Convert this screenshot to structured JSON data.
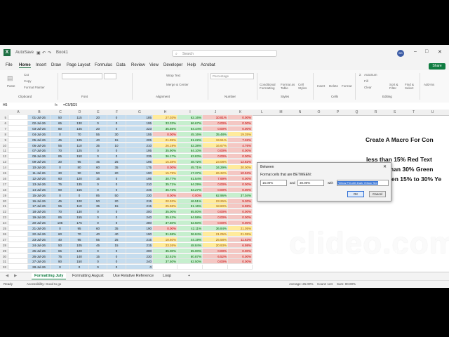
{
  "titlebar": {
    "autosave_label": "AutoSave",
    "workbook": "Book1",
    "search_placeholder": "Search",
    "user_initials": "BS"
  },
  "menu": [
    "File",
    "Home",
    "Insert",
    "Draw",
    "Page Layout",
    "Formulas",
    "Data",
    "Review",
    "View",
    "Developer",
    "Help",
    "Acrobat"
  ],
  "share_label": "Share",
  "ribbon": {
    "paste": "Paste",
    "cut": "Cut",
    "copy": "Copy",
    "format_painter": "Format Painter",
    "clipboard": "Clipboard",
    "font": "Font",
    "wrap_text": "Wrap Text",
    "merge_center": "Merge & Center",
    "alignment": "Alignment",
    "number_format": "Percentage",
    "number": "Number",
    "conditional": "Conditional Formatting",
    "format_table": "Format as Table",
    "cell_styles": "Cell Styles",
    "styles": "Styles",
    "insert": "Insert",
    "delete": "Delete",
    "format": "Format",
    "cells": "Cells",
    "autosum": "AutoSum",
    "fill": "Fill",
    "clear": "Clear",
    "sort_filter": "Sort & Filter",
    "find_select": "Find & Select",
    "editing": "Editing",
    "addins": "Add-ins"
  },
  "formula_bar": {
    "name_box": "H5",
    "fx": "fx",
    "formula": "=C5/$G5"
  },
  "columns": [
    "A",
    "B",
    "C",
    "D",
    "E",
    "F",
    "G",
    "H",
    "I",
    "J",
    "K",
    "L",
    "M",
    "N",
    "O",
    "P",
    "Q",
    "R",
    "S",
    "T",
    "U"
  ],
  "sheet_rows": [
    {
      "n": "5",
      "date": "01-Jul-26",
      "c": "50",
      "d": "115",
      "e": "20",
      "f": "0",
      "g": "185",
      "h": "27.03%",
      "i": "62.16%",
      "j": "10.81%",
      "k": "0.00%",
      "hs": "yellow",
      "is": "green",
      "js": "red",
      "ks": "red"
    },
    {
      "n": "6",
      "date": "02-Jul-26",
      "c": "65",
      "d": "130",
      "e": "0",
      "f": "0",
      "g": "195",
      "h": "33.33%",
      "i": "66.67%",
      "j": "0.00%",
      "k": "0.00%",
      "hs": "green",
      "is": "green",
      "js": "red",
      "ks": "red"
    },
    {
      "n": "7",
      "date": "03-Jul-26",
      "c": "80",
      "d": "145",
      "e": "20",
      "f": "0",
      "g": "223",
      "h": "35.56%",
      "i": "64.44%",
      "j": "0.00%",
      "k": "0.00%",
      "hs": "green",
      "is": "green",
      "js": "red",
      "ks": "red"
    },
    {
      "n": "8",
      "date": "04-Jul-26",
      "c": "0",
      "d": "70",
      "e": "55",
      "f": "30",
      "g": "155",
      "h": "0.00%",
      "i": "45.16%",
      "j": "35.48%",
      "k": "19.35%",
      "hs": "red",
      "is": "green",
      "js": "green",
      "ks": "yellow"
    },
    {
      "n": "9",
      "date": "05-Jul-26",
      "c": "45",
      "d": "105",
      "e": "40",
      "f": "15",
      "g": "205",
      "h": "21.95%",
      "i": "51.22%",
      "j": "19.51%",
      "k": "7.32%",
      "hs": "yellow",
      "is": "green",
      "js": "yellow",
      "ks": "red"
    },
    {
      "n": "10",
      "date": "06-Jul-26",
      "c": "55",
      "d": "110",
      "e": "35",
      "f": "10",
      "g": "210",
      "h": "26.19%",
      "i": "52.38%",
      "j": "16.67%",
      "k": "4.76%",
      "hs": "yellow",
      "is": "green",
      "js": "yellow",
      "ks": "red"
    },
    {
      "n": "11",
      "date": "07-Jul-26",
      "c": "70",
      "d": "125",
      "e": "0",
      "f": "0",
      "g": "195",
      "h": "35.90%",
      "i": "64.10%",
      "j": "0.00%",
      "k": "0.00%",
      "hs": "green",
      "is": "green",
      "js": "red",
      "ks": "red"
    },
    {
      "n": "12",
      "date": "08-Jul-26",
      "c": "85",
      "d": "150",
      "e": "0",
      "f": "0",
      "g": "235",
      "h": "36.17%",
      "i": "63.83%",
      "j": "0.00%",
      "k": "0.00%",
      "hs": "green",
      "is": "green",
      "js": "red",
      "ks": "red"
    },
    {
      "n": "13",
      "date": "09-Jul-26",
      "c": "30",
      "d": "95",
      "e": "45",
      "f": "25",
      "g": "195",
      "h": "15.38%",
      "i": "48.72%",
      "j": "23.08%",
      "k": "12.82%",
      "hs": "yellow",
      "is": "green",
      "js": "yellow",
      "ks": "red"
    },
    {
      "n": "14",
      "date": "10-Jul-26",
      "c": "0",
      "d": "80",
      "e": "60",
      "f": "35",
      "g": "175",
      "h": "0.00%",
      "i": "45.71%",
      "j": "34.29%",
      "k": "20.00%",
      "hs": "red",
      "is": "green",
      "js": "green",
      "ks": "yellow"
    },
    {
      "n": "15",
      "date": "11-Jul-26",
      "c": "30",
      "d": "90",
      "e": "50",
      "f": "20",
      "g": "190",
      "h": "15.79%",
      "i": "47.37%",
      "j": "26.32%",
      "k": "10.53%",
      "hs": "yellow",
      "is": "green",
      "js": "yellow",
      "ks": "red"
    },
    {
      "n": "16",
      "date": "12-Jul-26",
      "c": "60",
      "d": "120",
      "e": "15",
      "f": "0",
      "g": "195",
      "h": "30.77%",
      "i": "61.54%",
      "j": "7.69%",
      "k": "0.00%",
      "hs": "green",
      "is": "green",
      "js": "red",
      "ks": "red"
    },
    {
      "n": "17",
      "date": "13-Jul-26",
      "c": "75",
      "d": "135",
      "e": "0",
      "f": "0",
      "g": "210",
      "h": "35.71%",
      "i": "64.29%",
      "j": "0.00%",
      "k": "0.00%",
      "hs": "green",
      "is": "green",
      "js": "red",
      "ks": "red"
    },
    {
      "n": "18",
      "date": "14-Jul-26",
      "c": "90",
      "d": "155",
      "e": "0",
      "f": "0",
      "g": "245",
      "h": "36.73%",
      "i": "63.27%",
      "j": "0.00%",
      "k": "0.00%",
      "hs": "green",
      "is": "green",
      "js": "red",
      "ks": "red"
    },
    {
      "n": "19",
      "date": "15-Jul-26",
      "c": "0",
      "d": "0",
      "e": "85",
      "f": "50",
      "g": "230",
      "h": "0.00%",
      "i": "0.00%",
      "j": "62.96%",
      "k": "37.04%",
      "hs": "red",
      "is": "red",
      "js": "green",
      "ks": "green"
    },
    {
      "n": "20",
      "date": "16-Jul-26",
      "c": "45",
      "d": "100",
      "e": "50",
      "f": "20",
      "g": "215",
      "h": "20.93%",
      "i": "46.51%",
      "j": "23.26%",
      "k": "9.30%",
      "hs": "yellow",
      "is": "green",
      "js": "yellow",
      "ks": "red"
    },
    {
      "n": "21",
      "date": "17-Jul-26",
      "c": "55",
      "d": "110",
      "e": "35",
      "f": "15",
      "g": "215",
      "h": "25.58%",
      "i": "51.16%",
      "j": "18.60%",
      "k": "6.98%",
      "hs": "yellow",
      "is": "green",
      "js": "yellow",
      "ks": "red"
    },
    {
      "n": "22",
      "date": "18-Jul-26",
      "c": "70",
      "d": "130",
      "e": "0",
      "f": "0",
      "g": "200",
      "h": "35.00%",
      "i": "65.00%",
      "j": "0.00%",
      "k": "0.00%",
      "hs": "green",
      "is": "green",
      "js": "red",
      "ks": "red"
    },
    {
      "n": "23",
      "date": "19-Jul-26",
      "c": "85",
      "d": "155",
      "e": "0",
      "f": "0",
      "g": "240",
      "h": "35.42%",
      "i": "64.58%",
      "j": "0.00%",
      "k": "0.00%",
      "hs": "green",
      "is": "green",
      "js": "red",
      "ks": "red"
    },
    {
      "n": "24",
      "date": "20-Jul-26",
      "c": "105",
      "d": "175",
      "e": "0",
      "f": "0",
      "g": "280",
      "h": "37.50%",
      "i": "62.50%",
      "j": "0.00%",
      "k": "0.00%",
      "hs": "green",
      "is": "green",
      "js": "red",
      "ks": "red"
    },
    {
      "n": "25",
      "date": "21-Jul-26",
      "c": "0",
      "d": "95",
      "e": "60",
      "f": "35",
      "g": "190",
      "h": "0.00%",
      "i": "42.11%",
      "j": "36.84%",
      "k": "21.05%",
      "hs": "red",
      "is": "green",
      "js": "green",
      "ks": "yellow"
    },
    {
      "n": "26",
      "date": "22-Jul-26",
      "c": "60",
      "d": "70",
      "e": "40",
      "f": "40",
      "g": "190",
      "h": "31.58%",
      "i": "36.84%",
      "j": "21.05%",
      "k": "21.05%",
      "hs": "green",
      "is": "green",
      "js": "yellow",
      "ks": "yellow"
    },
    {
      "n": "27",
      "date": "23-Jul-26",
      "c": "40",
      "d": "95",
      "e": "55",
      "f": "25",
      "g": "215",
      "h": "18.60%",
      "i": "44.19%",
      "j": "25.58%",
      "k": "11.63%",
      "hs": "yellow",
      "is": "green",
      "js": "yellow",
      "ks": "red"
    },
    {
      "n": "28",
      "date": "24-Jul-26",
      "c": "50",
      "d": "105",
      "e": "45",
      "f": "15",
      "g": "215",
      "h": "23.26%",
      "i": "48.84%",
      "j": "20.93%",
      "k": "6.98%",
      "hs": "yellow",
      "is": "green",
      "js": "yellow",
      "ks": "red"
    },
    {
      "n": "29",
      "date": "25-Jul-26",
      "c": "65",
      "d": "120",
      "e": "0",
      "f": "0",
      "g": "200",
      "h": "35.00%",
      "i": "65.00%",
      "j": "0.00%",
      "k": "0.00%",
      "hs": "green",
      "is": "green",
      "js": "red",
      "ks": "red"
    },
    {
      "n": "30",
      "date": "26-Jul-26",
      "c": "75",
      "d": "140",
      "e": "15",
      "f": "0",
      "g": "230",
      "h": "32.61%",
      "i": "60.87%",
      "j": "6.52%",
      "k": "0.00%",
      "hs": "green",
      "is": "green",
      "js": "red",
      "ks": "red"
    },
    {
      "n": "31",
      "date": "27-Jul-26",
      "c": "90",
      "d": "150",
      "e": "0",
      "f": "0",
      "g": "240",
      "h": "37.50%",
      "i": "62.50%",
      "j": "0.00%",
      "k": "0.00%",
      "hs": "green",
      "is": "green",
      "js": "red",
      "ks": "red"
    },
    {
      "n": "32",
      "date": "28-Jul-26",
      "c": "0",
      "d": "0",
      "e": "0",
      "f": "0",
      "g": "0",
      "h": "",
      "i": "",
      "j": "",
      "k": "",
      "hs": "plain",
      "is": "plain",
      "js": "plain",
      "ks": "plain"
    }
  ],
  "side_text": {
    "line1": "Create A Macro For Con",
    "line2": "less than 15% Red Text",
    "line3": "han 30% Green",
    "line4": "en 15% to 30% Ye"
  },
  "dialog": {
    "title": "Between",
    "close": "✕",
    "prompt": "Format cells that are BETWEEN:",
    "value1": "15.00%",
    "and_label": "and",
    "value2": "30.00%",
    "with_label": "with",
    "format_option": "Yellow Fill with Dark Yellow Text",
    "ok": "OK",
    "cancel": "Cancel"
  },
  "sheet_tabs": [
    "Formatting July",
    "Formatting August",
    "Use Relative Reference",
    "Loop"
  ],
  "add_sheet": "+",
  "status": {
    "ready": "Ready",
    "accessibility": "Accessibility: Good to go",
    "average": "Average: 25.00%",
    "count": "Count: 124",
    "sum": "Sum: 00.00%"
  },
  "watermark": {
    "main": "clideo.com",
    "sub": "go"
  },
  "colors": {
    "excel_green": "#107c41",
    "blue_fill": "#c5dcee",
    "red_fill": "#f4c7c3",
    "green_fill": "#c6efce",
    "yellow_fill": "#ffeb9c"
  }
}
